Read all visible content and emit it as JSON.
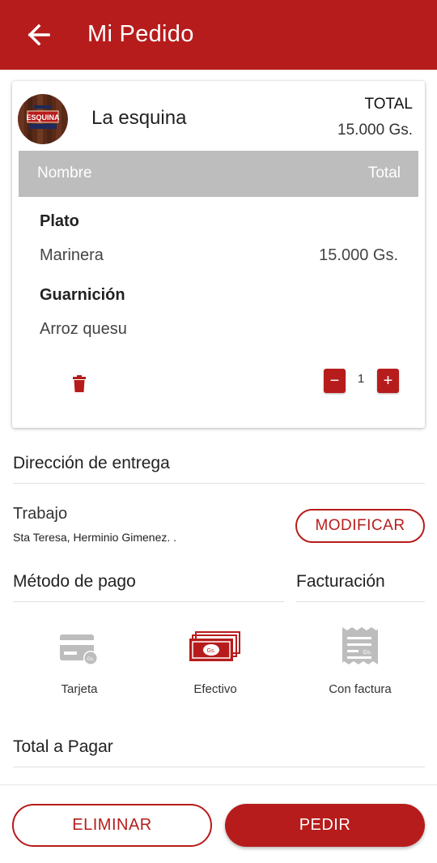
{
  "appbar": {
    "title": "Mi Pedido",
    "back_icon": "arrow-left-icon"
  },
  "colors": {
    "primary": "#b71c1c",
    "header_gray": "#bdbdbd",
    "icon_gray": "#bdbdbd"
  },
  "order": {
    "restaurant_name": "La esquina",
    "logo_text_top": "ESQUINA",
    "total_label": "TOTAL",
    "total_value": "15.000 Gs.",
    "table_header": {
      "name": "Nombre",
      "total": "Total"
    },
    "item": {
      "plato_label": "Plato",
      "plato_value": "Marinera",
      "plato_price": "15.000 Gs.",
      "guarnicion_label": "Guarnición",
      "guarnicion_value": "Arroz quesu",
      "quantity": "1",
      "minus": "−",
      "plus": "+"
    }
  },
  "delivery": {
    "heading": "Dirección de entrega",
    "label": "Trabajo",
    "address": "Sta Teresa, Herminio Gimenez. .",
    "modify_button": "MODIFICAR"
  },
  "payment": {
    "heading": "Método de pago",
    "options": [
      {
        "label": "Tarjeta",
        "icon": "credit-card-icon"
      },
      {
        "label": "Efectivo",
        "icon": "cash-icon"
      }
    ],
    "currency_badge": "Gs."
  },
  "billing": {
    "heading": "Facturación",
    "option": {
      "label": "Con factura",
      "icon": "receipt-icon"
    }
  },
  "total_to_pay": {
    "heading": "Total a Pagar"
  },
  "actions": {
    "delete_button": "ELIMINAR",
    "order_button": "PEDIR"
  }
}
